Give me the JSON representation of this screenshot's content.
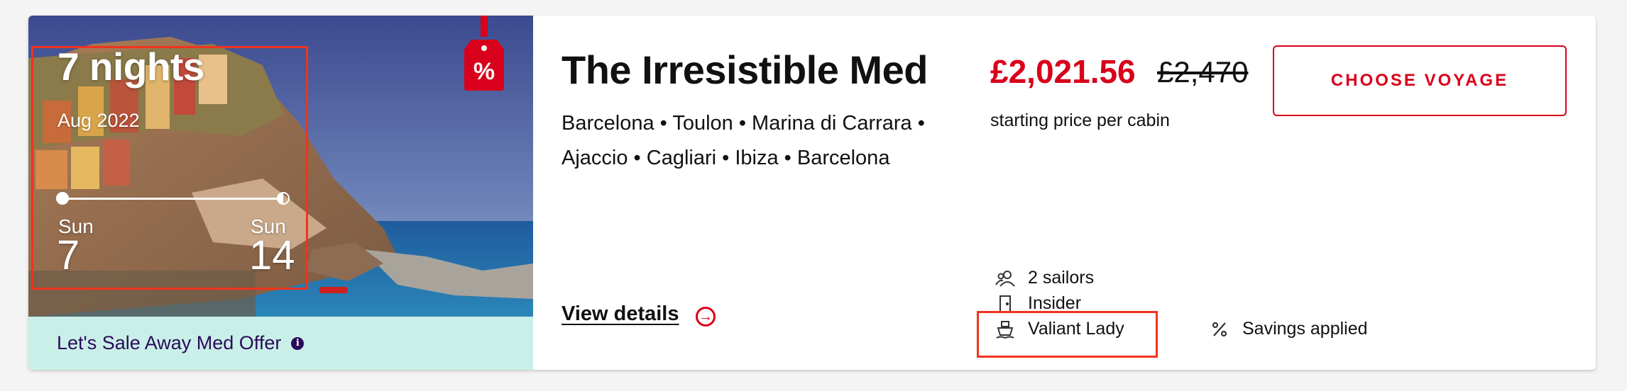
{
  "image_panel": {
    "duration": "7 nights",
    "month": "Aug 2022",
    "start_day": "Sun",
    "start_date": "7",
    "end_day": "Sun",
    "end_date": "14",
    "sale_tag_symbol": "%"
  },
  "offer": {
    "text": "Let's Sale Away Med Offer",
    "info_symbol": "i"
  },
  "voyage": {
    "title": "The Irresistible Med",
    "route": "Barcelona • Toulon • Marina di Carrara • Ajaccio • Cagliari • Ibiza • Barcelona",
    "view_details": "View details"
  },
  "pricing": {
    "price": "£2,021.56",
    "original_price": "£2,470",
    "note": "starting price per cabin",
    "cta": "CHOOSE VOYAGE"
  },
  "meta": {
    "sailors": "2 sailors",
    "cabin": "Insider",
    "ship": "Valiant Lady",
    "savings": "Savings applied"
  },
  "colors": {
    "accent_red": "#d8001a",
    "offer_bg": "#c9f0e8",
    "offer_text": "#2b0a5a",
    "highlight_box": "#f0331e"
  }
}
